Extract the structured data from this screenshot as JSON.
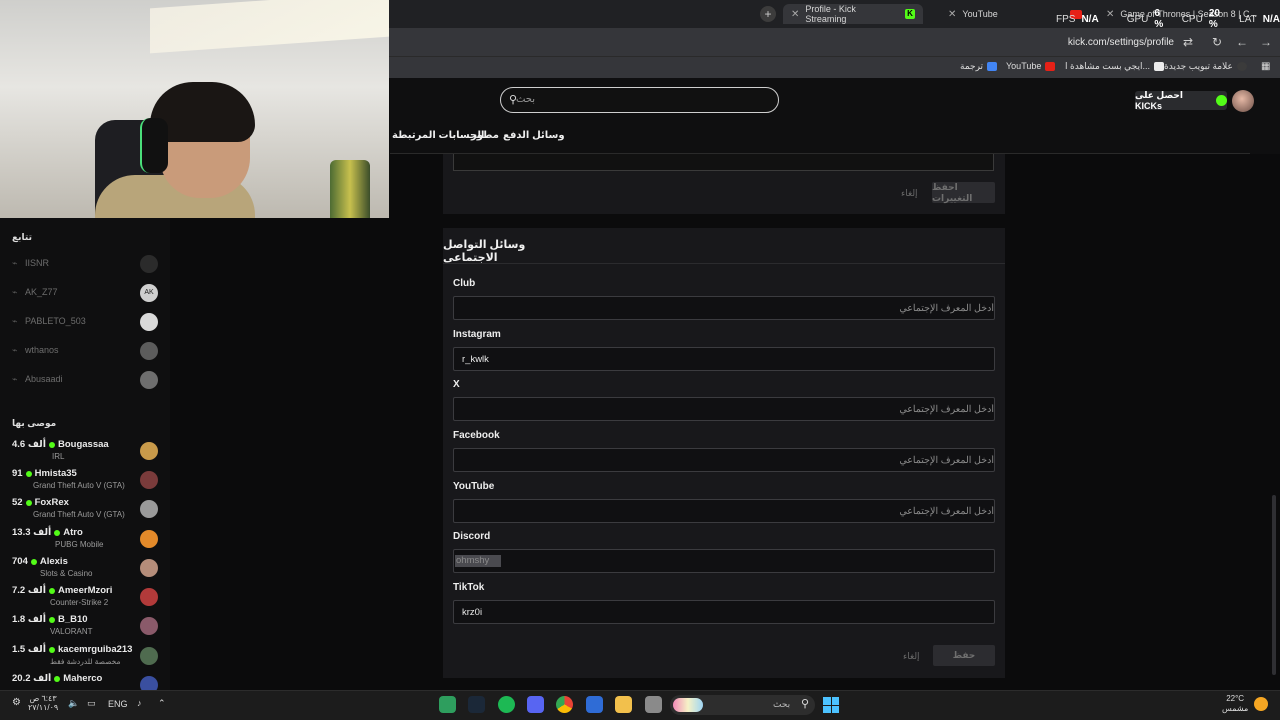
{
  "browser": {
    "tabs": [
      {
        "label": "Profile - Kick Streaming"
      },
      {
        "label": "YouTube"
      },
      {
        "label": "Game of Thrones | Season 8 | C..."
      }
    ],
    "new_tab": "+",
    "perf": {
      "fps_label": "FPS",
      "fps_val": "N/A",
      "gpu_label": "GPU",
      "gpu_val": "6 %",
      "cpu_label": "CPU",
      "cpu_val": "20 %",
      "lat_label": "LAT",
      "lat_val": "N/A"
    },
    "url": "kick.com/settings/profile",
    "bookmarks": [
      {
        "label": "علامة تبويب جديدة"
      },
      {
        "label": "ايجي بست مشاهدة ا..."
      },
      {
        "label": "YouTube"
      },
      {
        "label": "ترجمة"
      }
    ]
  },
  "site": {
    "search_placeholder": "بحث",
    "get_kicks": "احصل على KICKs",
    "settings_tabs": [
      "وسائل الدفع",
      "مطور",
      "الحسابات المرتبطة"
    ]
  },
  "sidebar": {
    "following_title": "تتابع",
    "following": [
      {
        "name": "IISNR",
        "avatar": "#2b2b2b"
      },
      {
        "name": "AK_Z77",
        "avatar": "#cfcfcf",
        "initials": "AK"
      },
      {
        "name": "PABLETO_503",
        "avatar": "#d9d9d9"
      },
      {
        "name": "wthanos",
        "avatar": "#5c5c5c"
      },
      {
        "name": "Abusaadi",
        "avatar": "#6e6e6e"
      }
    ],
    "recommended_title": "موصى بها",
    "recommended": [
      {
        "name": "Bougassaa",
        "viewers": "4.6 ألف",
        "category": "IRL",
        "avatar": "#c89a4a"
      },
      {
        "name": "Hmista35",
        "viewers": "91",
        "category": "Grand Theft Auto V (GTA)",
        "avatar": "#7a3b3b"
      },
      {
        "name": "FoxRex",
        "viewers": "52",
        "category": "Grand Theft Auto V (GTA)",
        "avatar": "#9a9a9a"
      },
      {
        "name": "Atro",
        "viewers": "13.3 ألف",
        "category": "PUBG Mobile",
        "avatar": "#e38a2a"
      },
      {
        "name": "Alexis",
        "viewers": "704",
        "category": "Slots & Casino",
        "avatar": "#b58d7a"
      },
      {
        "name": "AmeerMzori",
        "viewers": "7.2 ألف",
        "category": "Counter-Strike 2",
        "avatar": "#b23a3a"
      },
      {
        "name": "B_B10",
        "viewers": "1.8 ألف",
        "category": "VALORANT",
        "avatar": "#8a5a6a"
      },
      {
        "name": "kacemrguiba213",
        "viewers": "1.5 ألف",
        "category": "مخصصة للدردشة فقط",
        "avatar": "#4f6b4f"
      },
      {
        "name": "Maherco",
        "viewers": "20.2 ألف",
        "category": "",
        "avatar": "#3a4fa0"
      }
    ]
  },
  "top_card": {
    "save_label": "احفظ التغييرات",
    "cancel_label": "إلغاء"
  },
  "social": {
    "title": "وسائل التواصل الاجتماعي",
    "fields": [
      {
        "label": "Club",
        "value": "",
        "placeholder": "أدخل المعرف الإجتماعي"
      },
      {
        "label": "Instagram",
        "value": "r_kwlk",
        "placeholder": "أدخل المعرف الإجتماعي"
      },
      {
        "label": "X",
        "value": "",
        "placeholder": "أدخل المعرف الإجتماعي"
      },
      {
        "label": "Facebook",
        "value": "",
        "placeholder": "أدخل المعرف الإجتماعي"
      },
      {
        "label": "YouTube",
        "value": "",
        "placeholder": "أدخل المعرف الإجتماعي"
      },
      {
        "label": "Discord",
        "value": "ohmshy",
        "placeholder": "أدخل المعرف الإجتماعي"
      },
      {
        "label": "TikTok",
        "value": "krz0i",
        "placeholder": "أدخل المعرف الإجتماعي"
      }
    ],
    "save_label": "حفظ",
    "cancel_label": "إلغاء"
  },
  "taskbar": {
    "search_text": "بحث",
    "weather_temp": "22°C",
    "weather_desc": "مشمس",
    "lang": "ENG",
    "time": "٦:٤٣ ص",
    "date": "٢٧/١١/٠٩",
    "apps": [
      {
        "name": "app-green",
        "color": "#2e9e5e"
      },
      {
        "name": "steam",
        "color": "#1b2838"
      },
      {
        "name": "spotify",
        "color": "#1db954"
      },
      {
        "name": "discord",
        "color": "#5865f2"
      },
      {
        "name": "chrome",
        "color": "#e9b132"
      },
      {
        "name": "app-blue",
        "color": "#2f6cd6"
      },
      {
        "name": "file-explorer",
        "color": "#f2c04c"
      },
      {
        "name": "app-grey",
        "color": "#8a8a8a"
      }
    ]
  },
  "colors": {
    "kick_green": "#53fc18",
    "card_bg": "#18181b"
  }
}
